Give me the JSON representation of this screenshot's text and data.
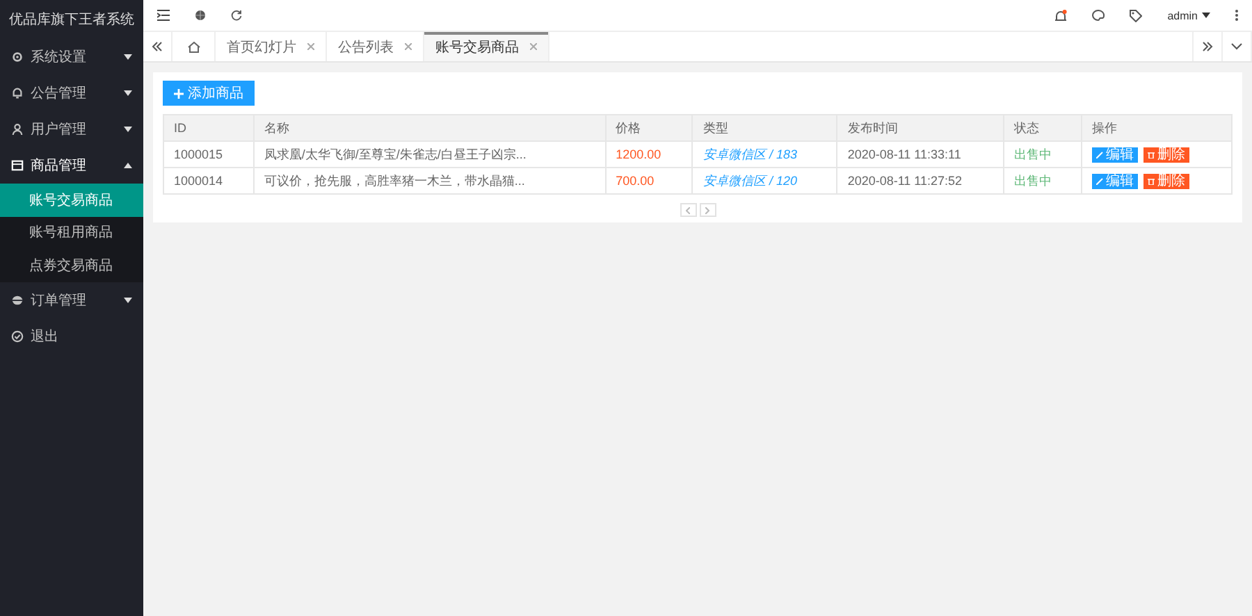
{
  "app_title": "优品库旗下王者系统",
  "menu": [
    {
      "label": "系统设置",
      "kind": "group",
      "expanded": false
    },
    {
      "label": "公告管理",
      "kind": "group",
      "expanded": false
    },
    {
      "label": "用户管理",
      "kind": "group",
      "expanded": false
    },
    {
      "label": "商品管理",
      "kind": "group",
      "expanded": true,
      "children": [
        {
          "label": "账号交易商品",
          "selected": true
        },
        {
          "label": "账号租用商品",
          "selected": false
        },
        {
          "label": "点券交易商品",
          "selected": false
        }
      ]
    },
    {
      "label": "订单管理",
      "kind": "group",
      "expanded": false
    },
    {
      "label": "退出",
      "kind": "link"
    }
  ],
  "header": {
    "user": "admin",
    "has_notification": true
  },
  "tabs": [
    {
      "label": "首页幻灯片",
      "selected": false
    },
    {
      "label": "公告列表",
      "selected": false
    },
    {
      "label": "账号交易商品",
      "selected": true
    }
  ],
  "add_button": "添加商品",
  "table": {
    "columns": [
      "ID",
      "名称",
      "价格",
      "类型",
      "发布时间",
      "状态",
      "操作"
    ],
    "rows": [
      {
        "id": "1000015",
        "name": "凤求凰/太华飞御/至尊宝/朱雀志/白昼王子凶宗...",
        "price": "1200.00",
        "type": "安卓微信区 / 183",
        "time": "2020-08-11 11:33:11",
        "status": "出售中",
        "actions": [
          "编辑",
          "删除"
        ]
      },
      {
        "id": "1000014",
        "name": "可议价，抢先服，高胜率猪一木兰，带水晶猫...",
        "price": "700.00",
        "type": "安卓微信区 / 120",
        "time": "2020-08-11 11:27:52",
        "status": "出售中",
        "actions": [
          "编辑",
          "删除"
        ]
      }
    ]
  }
}
